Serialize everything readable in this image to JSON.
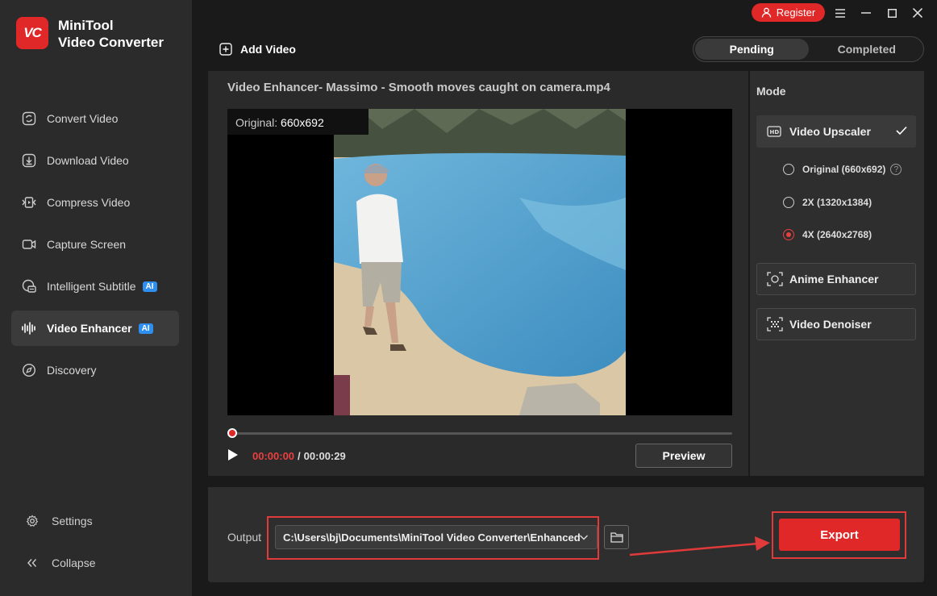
{
  "app": {
    "logo_text": "VC",
    "name_line1": "MiniTool",
    "name_line2": "Video Converter",
    "register_label": "Register",
    "brand_color": "#e02828"
  },
  "sidebar": {
    "items": [
      {
        "label": "Convert Video",
        "icon": "convert-icon"
      },
      {
        "label": "Download Video",
        "icon": "download-icon"
      },
      {
        "label": "Compress Video",
        "icon": "compress-icon"
      },
      {
        "label": "Capture Screen",
        "icon": "camera-icon"
      },
      {
        "label": "Intelligent Subtitle",
        "icon": "subtitle-icon",
        "badge": "AI"
      },
      {
        "label": "Video Enhancer",
        "icon": "waveform-icon",
        "badge": "AI",
        "active": true
      },
      {
        "label": "Discovery",
        "icon": "compass-icon"
      }
    ],
    "settings_label": "Settings",
    "collapse_label": "Collapse"
  },
  "toolbar": {
    "add_video_label": "Add Video",
    "tabs": [
      "Pending",
      "Completed"
    ],
    "active_tab": "Pending"
  },
  "editor": {
    "title": "Video Enhancer- Massimo - Smooth moves caught on camera.mp4",
    "original_prefix": "Original: ",
    "original_value": "660x692",
    "current_time": "00:00:00",
    "time_separator": "/",
    "total_time": "00:00:29",
    "progress": 0,
    "preview_label": "Preview"
  },
  "mode": {
    "title": "Mode",
    "upscaler_label": "Video Upscaler",
    "options": [
      {
        "label": "Original (660x692)",
        "selected": false,
        "help": "?"
      },
      {
        "label": "2X (1320x1384)",
        "selected": false
      },
      {
        "label": "4X (2640x2768)",
        "selected": true
      }
    ],
    "anime_label": "Anime Enhancer",
    "denoiser_label": "Video Denoiser"
  },
  "output": {
    "label": "Output",
    "path": "C:\\Users\\bj\\Documents\\MiniTool Video Converter\\Enhanced",
    "export_label": "Export"
  }
}
